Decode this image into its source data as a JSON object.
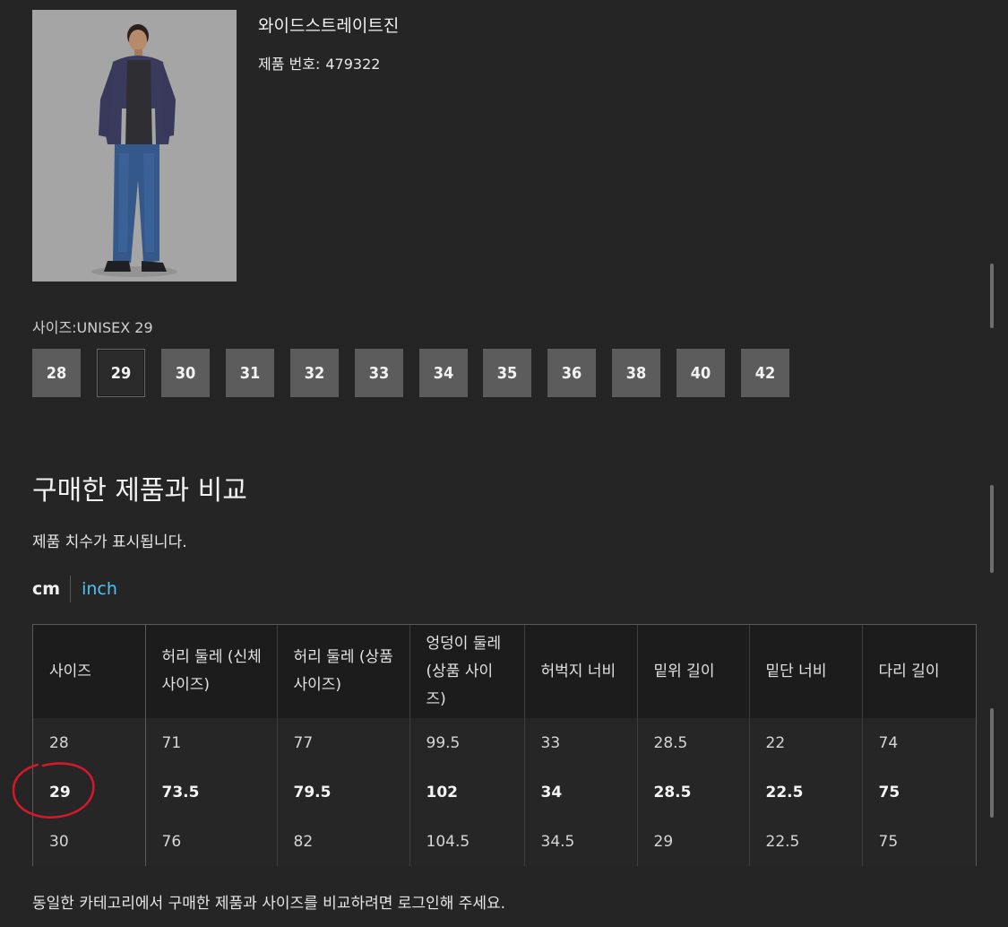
{
  "product": {
    "title": "와이드스트레이트진",
    "number_label": "제품 번호:",
    "number": "479322",
    "image_desc": "model-photo"
  },
  "size_selector": {
    "label": "사이즈:UNISEX 29",
    "options": [
      "28",
      "29",
      "30",
      "31",
      "32",
      "33",
      "34",
      "35",
      "36",
      "38",
      "40",
      "42"
    ],
    "selected": "29"
  },
  "compare": {
    "title": "구매한 제품과 비교",
    "description": "제품 치수가 표시됩니다.",
    "units": {
      "cm": "cm",
      "inch": "inch",
      "active": "cm"
    },
    "table": {
      "headers": [
        "사이즈",
        "허리 둘레 (신체 사이즈)",
        "허리 둘레 (상품 사이즈)",
        "엉덩이 둘레 (상품 사이즈)",
        "허벅지 너비",
        "밑위 길이",
        "밑단 너비",
        "다리 길이"
      ],
      "rows": [
        [
          "28",
          "71",
          "77",
          "99.5",
          "33",
          "28.5",
          "22",
          "74"
        ],
        [
          "29",
          "73.5",
          "79.5",
          "102",
          "34",
          "28.5",
          "22.5",
          "75"
        ],
        [
          "30",
          "76",
          "82",
          "104.5",
          "34.5",
          "29",
          "22.5",
          "75"
        ]
      ],
      "highlighted_row": "29"
    },
    "login_note": "동일한 카테고리에서 구매한 제품과 사이즈를 비교하려면 로그인해 주세요."
  },
  "colors": {
    "background": "#252525",
    "size_button": "#5c5c5c",
    "link": "#4fc3f7",
    "annotation": "#d6182a"
  }
}
